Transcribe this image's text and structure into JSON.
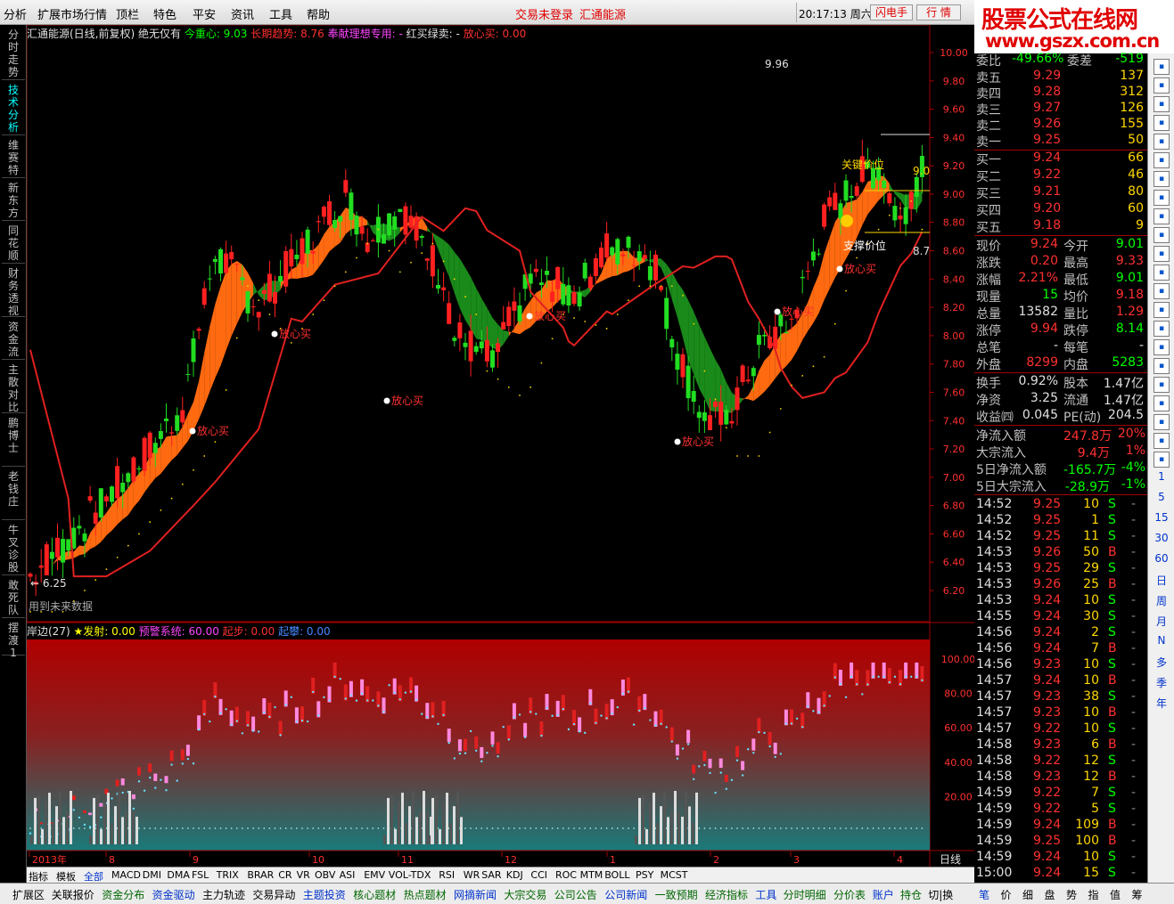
{
  "menu": {
    "items": [
      "分析",
      "扩展市场行情",
      "顶栏",
      "特色",
      "平安",
      "资讯",
      "工具",
      "帮助"
    ],
    "status": "交易未登录",
    "stock": "汇通能源",
    "time": "20:17:13 周六",
    "btn1": "闪电手",
    "btn2": "行  情"
  },
  "logo": {
    "line1": "股票公式在线网",
    "line2": "www.gszx.com.cn"
  },
  "sidebar": [
    "分时走势",
    "技术分析",
    "维赛特",
    "新东方",
    "同花顺",
    "财务透视",
    "资金流",
    "主散对比",
    "鹏博士",
    "老钱庄",
    "牛叉诊股",
    "敢死队",
    "摆渡1"
  ],
  "main_title": {
    "name": "汇通能源(日线,前复权) 绝无仅有",
    "items": [
      {
        "t": "今重心: 9.03",
        "c": "#00ff00"
      },
      {
        "t": "长期趋势: 8.76",
        "c": "#ff3030"
      },
      {
        "t": "奉献理想专用: -",
        "c": "#ff44ff"
      },
      {
        "t": "红买绿卖: -",
        "c": "#e0e0e0"
      },
      {
        "t": "放心买: 0.00",
        "c": "#ff3030"
      }
    ]
  },
  "sub_title": {
    "name": "岸边(27)",
    "items": [
      {
        "t": "★发射: 0.00",
        "c": "#ffff00"
      },
      {
        "t": "预警系统: 60.00",
        "c": "#ff44ff"
      },
      {
        "t": "起步: 0.00",
        "c": "#ff3030"
      },
      {
        "t": "起攀: 0.00",
        "c": "#4488ff"
      }
    ]
  },
  "price_axis": [
    "10.00",
    "9.80",
    "9.60",
    "9.40",
    "9.20",
    "9.00",
    "8.80",
    "8.60",
    "8.40",
    "8.20",
    "8.00",
    "7.80",
    "7.60",
    "7.40",
    "7.20",
    "7.00",
    "6.80",
    "6.60",
    "6.40",
    "6.20"
  ],
  "sub_axis": [
    "100.00",
    "80.00",
    "60.00",
    "40.00",
    "20.00"
  ],
  "annotations": {
    "high": "9.96",
    "low": "6.25",
    "note": "用到未来数据",
    "buy": "放心买",
    "pressure": "关键价位",
    "support": "支撑价位",
    "v90": "9.0",
    "v87": "8.7"
  },
  "date_axis": [
    "2013年",
    "8",
    "9",
    "10",
    "11",
    "12",
    "1",
    "2",
    "3",
    "4"
  ],
  "period": "日线",
  "indicator_tabs": [
    "指标",
    "模板",
    "全部",
    "MACD",
    "DMI",
    "DMA",
    "FSL",
    "TRIX",
    "BRAR",
    "CR",
    "VR",
    "OBV",
    "ASI",
    "EMV",
    "VOL-TDX",
    "RSI",
    "WR",
    "SAR",
    "KDJ",
    "CCI",
    "ROC",
    "MTM",
    "BOLL",
    "PSY",
    "MCST"
  ],
  "bottom_tabs": [
    "扩展区",
    "关联报价",
    "资金分布",
    "资金驱动",
    "主力轨迹",
    "交易异动",
    "主题投资",
    "核心题材",
    "热点题材",
    "网摘新闻",
    "大宗交易",
    "公司公告",
    "公司新闻",
    "一致预期",
    "经济指标",
    "工具",
    "分时明细",
    "分价表",
    "账户",
    "持仓",
    "切|换"
  ],
  "right_bottom_tabs": [
    "笔",
    "价",
    "细",
    "盘",
    "势",
    "指",
    "值",
    "筹"
  ],
  "quote": {
    "weibi": {
      "label": "委比",
      "v": "-49.66%",
      "label2": "委差",
      "v2": "-519"
    },
    "sell": [
      {
        "l": "卖五",
        "p": "9.29",
        "q": "137"
      },
      {
        "l": "卖四",
        "p": "9.28",
        "q": "312"
      },
      {
        "l": "卖三",
        "p": "9.27",
        "q": "126"
      },
      {
        "l": "卖二",
        "p": "9.26",
        "q": "155"
      },
      {
        "l": "卖一",
        "p": "9.25",
        "q": "50"
      }
    ],
    "buy": [
      {
        "l": "买一",
        "p": "9.24",
        "q": "66"
      },
      {
        "l": "买二",
        "p": "9.22",
        "q": "46"
      },
      {
        "l": "买三",
        "p": "9.21",
        "q": "80"
      },
      {
        "l": "买四",
        "p": "9.20",
        "q": "60"
      },
      {
        "l": "买五",
        "p": "9.18",
        "q": "9"
      }
    ],
    "stats": [
      {
        "a": "现价",
        "av": "9.24",
        "ac": "#ff3030",
        "b": "今开",
        "bv": "9.01",
        "bc": "#00ff00"
      },
      {
        "a": "涨跌",
        "av": "0.20",
        "ac": "#ff3030",
        "b": "最高",
        "bv": "9.33",
        "bc": "#ff3030"
      },
      {
        "a": "涨幅",
        "av": "2.21%",
        "ac": "#ff3030",
        "b": "最低",
        "bv": "9.01",
        "bc": "#00ff00"
      },
      {
        "a": "现量",
        "av": "15",
        "ac": "#00ff00",
        "b": "均价",
        "bv": "9.18",
        "bc": "#ff3030"
      },
      {
        "a": "总量",
        "av": "13582",
        "ac": "#e0e0e0",
        "b": "量比",
        "bv": "1.29",
        "bc": "#ff3030"
      },
      {
        "a": "涨停",
        "av": "9.94",
        "ac": "#ff3030",
        "b": "跌停",
        "bv": "8.14",
        "bc": "#00ff00"
      },
      {
        "a": "总笔",
        "av": "-",
        "ac": "#e0e0e0",
        "b": "每笔",
        "bv": "-",
        "bc": "#e0e0e0"
      },
      {
        "a": "外盘",
        "av": "8299",
        "ac": "#ff3030",
        "b": "内盘",
        "bv": "5283",
        "bc": "#00ff00"
      }
    ],
    "fin": [
      {
        "a": "换手",
        "av": "0.92%",
        "b": "股本",
        "bv": "1.47亿"
      },
      {
        "a": "净资",
        "av": "3.25",
        "b": "流通",
        "bv": "1.47亿"
      },
      {
        "a": "收益㈣",
        "av": "0.045",
        "b": "PE(动)",
        "bv": "204.5"
      }
    ],
    "flow": [
      {
        "l": "净流入额",
        "v": "247.8万",
        "p": "20%",
        "c": "#ff3030"
      },
      {
        "l": "大宗流入",
        "v": "9.4万",
        "p": "1%",
        "c": "#ff3030"
      },
      {
        "l": "5日净流入额",
        "v": "-165.7万",
        "p": "-4%",
        "c": "#00ff00"
      },
      {
        "l": "5日大宗流入",
        "v": "-28.9万",
        "p": "-1%",
        "c": "#00ff00"
      }
    ]
  },
  "ticks": [
    {
      "t": "14:52",
      "p": "9.25",
      "v": "10",
      "s": "S"
    },
    {
      "t": "14:52",
      "p": "9.25",
      "v": "1",
      "s": "S"
    },
    {
      "t": "14:52",
      "p": "9.25",
      "v": "11",
      "s": "S"
    },
    {
      "t": "14:53",
      "p": "9.26",
      "v": "50",
      "s": "B"
    },
    {
      "t": "14:53",
      "p": "9.25",
      "v": "29",
      "s": "S"
    },
    {
      "t": "14:53",
      "p": "9.26",
      "v": "25",
      "s": "B"
    },
    {
      "t": "14:53",
      "p": "9.24",
      "v": "10",
      "s": "S"
    },
    {
      "t": "14:55",
      "p": "9.24",
      "v": "30",
      "s": "S"
    },
    {
      "t": "14:56",
      "p": "9.24",
      "v": "2",
      "s": "S"
    },
    {
      "t": "14:56",
      "p": "9.24",
      "v": "7",
      "s": "B"
    },
    {
      "t": "14:56",
      "p": "9.23",
      "v": "10",
      "s": "S"
    },
    {
      "t": "14:57",
      "p": "9.24",
      "v": "10",
      "s": "B"
    },
    {
      "t": "14:57",
      "p": "9.23",
      "v": "38",
      "s": "S"
    },
    {
      "t": "14:57",
      "p": "9.23",
      "v": "10",
      "s": "B"
    },
    {
      "t": "14:57",
      "p": "9.22",
      "v": "10",
      "s": "S"
    },
    {
      "t": "14:58",
      "p": "9.23",
      "v": "6",
      "s": "B"
    },
    {
      "t": "14:58",
      "p": "9.22",
      "v": "12",
      "s": "S"
    },
    {
      "t": "14:58",
      "p": "9.23",
      "v": "12",
      "s": "B"
    },
    {
      "t": "14:59",
      "p": "9.22",
      "v": "7",
      "s": "S"
    },
    {
      "t": "14:59",
      "p": "9.22",
      "v": "5",
      "s": "S"
    },
    {
      "t": "14:59",
      "p": "9.24",
      "v": "109",
      "s": "B"
    },
    {
      "t": "14:59",
      "p": "9.25",
      "v": "100",
      "s": "B"
    },
    {
      "t": "14:59",
      "p": "9.24",
      "v": "10",
      "s": "S"
    },
    {
      "t": "15:00",
      "p": "9.24",
      "v": "15",
      "s": "S"
    }
  ],
  "right_tools": [
    "1",
    "5",
    "15",
    "30",
    "60",
    "日",
    "周",
    "月",
    "N",
    "多",
    "季",
    "年"
  ],
  "colors": {
    "up": "#ff3030",
    "down": "#00ff00",
    "bg": "#000000"
  }
}
